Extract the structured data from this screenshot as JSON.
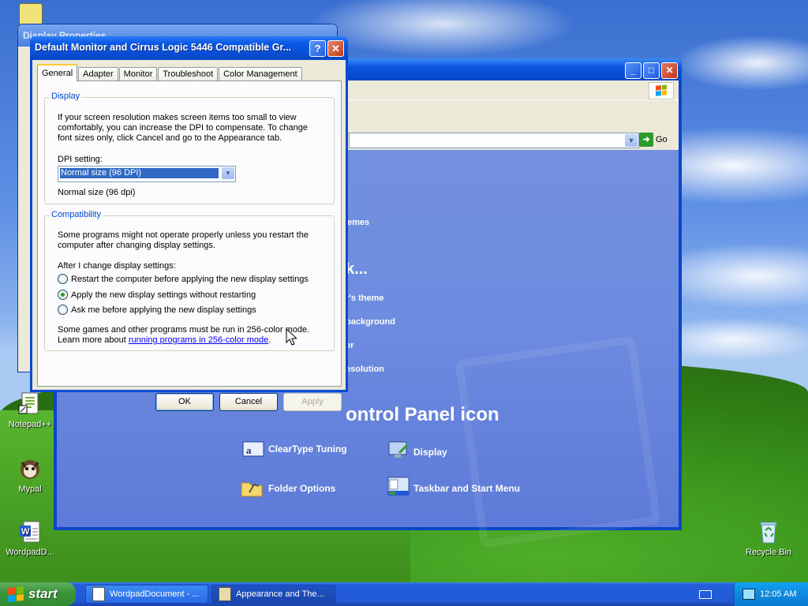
{
  "desktop": {
    "icons": [
      {
        "label": "Notepad++"
      },
      {
        "label": "Mypal"
      },
      {
        "label": "WordpadD..."
      },
      {
        "label": "Recycle Bin"
      }
    ]
  },
  "control_panel": {
    "go_label": "Go",
    "links": [
      "emes",
      "r's theme",
      "background",
      "er",
      "esolution"
    ],
    "heading_partial": "k...",
    "heading": "ontrol Panel icon",
    "items": [
      {
        "label": "ClearType Tuning"
      },
      {
        "label": "Display"
      },
      {
        "label": "Folder Options"
      },
      {
        "label": "Taskbar and Start Menu"
      }
    ]
  },
  "back_dialog": {
    "title": "Display Properties"
  },
  "dialog": {
    "title": "Default Monitor and Cirrus Logic 5446 Compatible Gr...",
    "help_label": "?",
    "close_label": "✕",
    "tabs": [
      "General",
      "Adapter",
      "Monitor",
      "Troubleshoot",
      "Color Management"
    ],
    "display_group": {
      "legend": "Display",
      "desc1": "If your screen resolution makes screen items too small to view",
      "desc2": "comfortably, you can increase the DPI to compensate.  To change",
      "desc3": "font sizes only, click Cancel and go to the Appearance tab.",
      "dpi_label": "DPI setting:",
      "dpi_value": "Normal size (96 DPI)",
      "dpi_note": "Normal size (96 dpi)"
    },
    "compat_group": {
      "legend": "Compatibility",
      "desc1": "Some programs might not operate properly unless you restart the",
      "desc2": "computer after changing display settings.",
      "after_label": "After I change display settings:",
      "options": [
        {
          "label": "Restart the computer before applying the new display settings",
          "selected": false
        },
        {
          "label": "Apply the new display settings without restarting",
          "selected": true
        },
        {
          "label": "Ask me before applying the new display settings",
          "selected": false
        }
      ],
      "note1": "Some games and other programs must be run in 256-color mode.",
      "note2_prefix": "Learn more about ",
      "note2_link": "running programs in 256-color mode",
      "note2_suffix": "."
    },
    "buttons": {
      "ok": "OK",
      "cancel": "Cancel",
      "apply": "Apply"
    }
  },
  "taskbar": {
    "start_label": "start",
    "tasks": [
      {
        "label": "WordpadDocument - ...",
        "active": false
      },
      {
        "label": "Appearance and The...",
        "active": true
      }
    ],
    "clock": "12:05 AM"
  }
}
